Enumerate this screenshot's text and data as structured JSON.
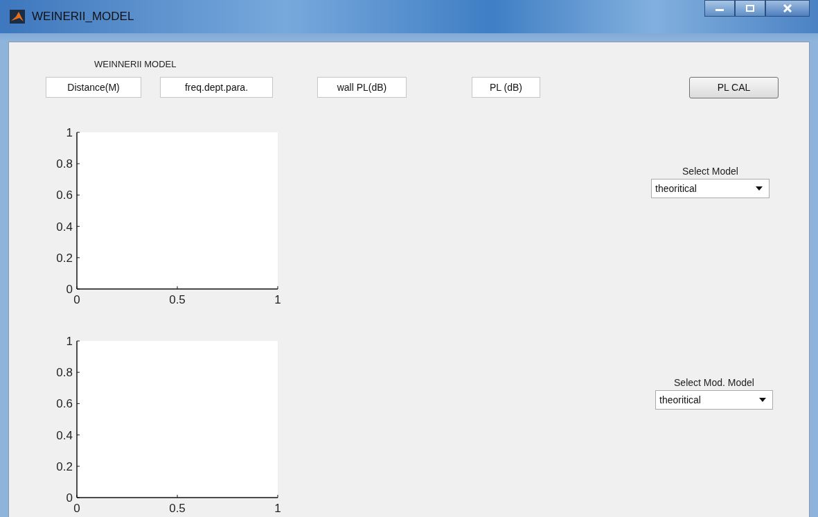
{
  "window": {
    "title": "WEINERII_MODEL"
  },
  "heading": "WEINNERII MODEL",
  "fields": [
    {
      "value": "Distance(M)"
    },
    {
      "value": "freq.dept.para."
    },
    {
      "value": "wall PL(dB)"
    },
    {
      "value": "PL (dB)"
    }
  ],
  "button": {
    "label": "PL CAL"
  },
  "panels": [
    {
      "chart_data": {
        "type": "line",
        "xlim": [
          0,
          1
        ],
        "ylim": [
          0,
          1
        ],
        "xticks": [
          0,
          0.5,
          1
        ],
        "yticks": [
          0,
          0.2,
          0.4,
          0.6,
          0.8,
          1
        ]
      },
      "select": {
        "label": "Select Model",
        "value": "theoritical"
      }
    },
    {
      "chart_data": {
        "type": "line",
        "xlim": [
          0,
          1
        ],
        "ylim": [
          0,
          1
        ],
        "xticks": [
          0,
          0.5,
          1
        ],
        "yticks": [
          0,
          0.2,
          0.4,
          0.6,
          0.8,
          1
        ]
      },
      "select": {
        "label": "Select Mod. Model",
        "value": "theoritical"
      }
    }
  ]
}
